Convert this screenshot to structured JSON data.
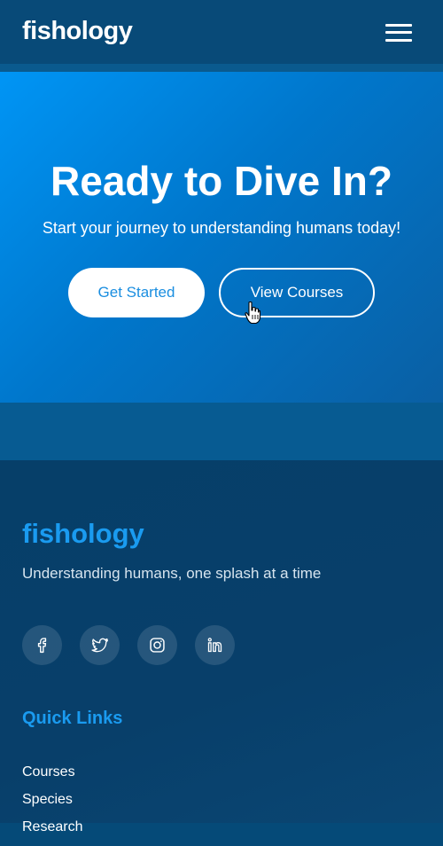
{
  "header": {
    "logo": "fishology",
    "menu_icon": "hamburger-menu-icon"
  },
  "hero": {
    "title": "Ready to Dive In?",
    "subtitle": "Start your journey to understanding humans today!",
    "primary_button": "Get Started",
    "secondary_button": "View Courses"
  },
  "footer": {
    "brand": "fishology",
    "tagline": "Understanding humans, one splash at a time",
    "social": [
      {
        "icon": "facebook-icon"
      },
      {
        "icon": "twitter-icon"
      },
      {
        "icon": "instagram-icon"
      },
      {
        "icon": "linkedin-icon"
      }
    ],
    "quick_links_title": "Quick Links",
    "quick_links": [
      "Courses",
      "Species",
      "Research"
    ]
  },
  "colors": {
    "header_bg": "#084a78",
    "hero_gradient_start": "#0095f5",
    "accent": "#1a9bf0",
    "footer_bg": "#063f69"
  }
}
